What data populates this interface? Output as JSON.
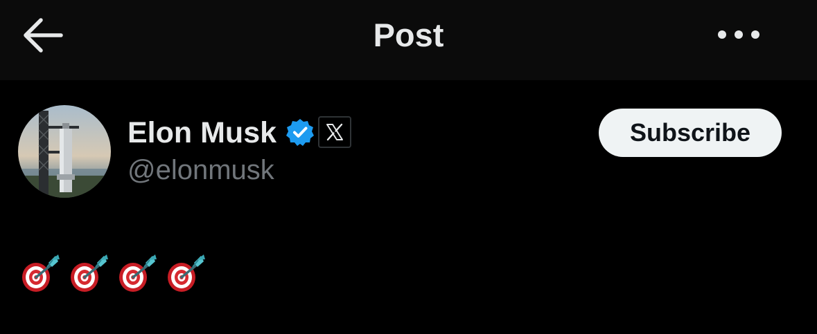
{
  "header": {
    "title": "Post",
    "back_icon": "arrow-left-icon",
    "more_icon": "ellipsis-horizontal-icon"
  },
  "author": {
    "display_name": "Elon Musk",
    "handle": "@elonmusk",
    "verified_icon": "verified-badge-icon",
    "affiliate_icon": "x-logo-icon",
    "avatar": "rocket-launch-tower-photo"
  },
  "actions": {
    "subscribe_label": "Subscribe"
  },
  "post": {
    "content_icons": [
      "direct-hit-emoji",
      "direct-hit-emoji",
      "direct-hit-emoji",
      "direct-hit-emoji"
    ]
  },
  "colors": {
    "background": "#000000",
    "header_background": "#0b0b0b",
    "primary_text": "#e7e9ea",
    "secondary_text": "#71767b",
    "verified_blue": "#1d9bf0",
    "button_background": "#eff3f4",
    "button_text": "#0f1419"
  }
}
